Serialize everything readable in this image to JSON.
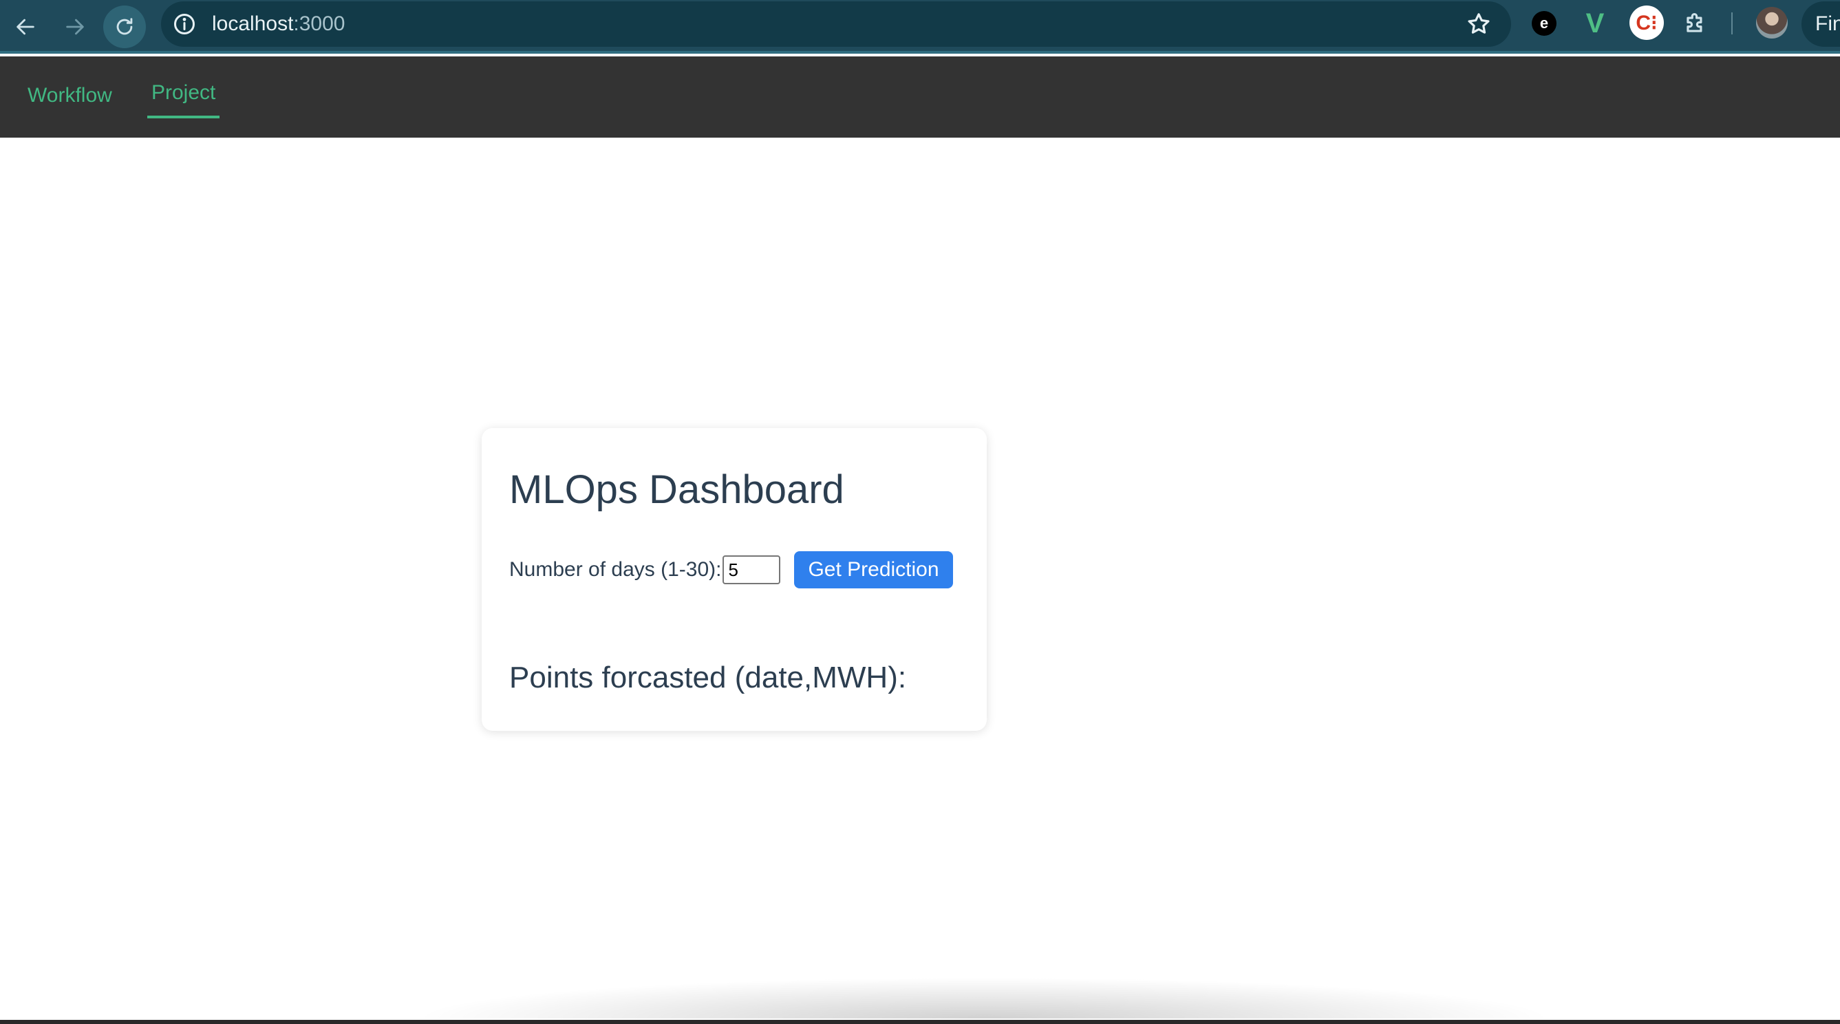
{
  "browser": {
    "url_host": "localhost",
    "url_port": ":3000",
    "profile_label": "Fin",
    "icons": [
      "back-arrow-icon",
      "forward-arrow-icon",
      "reload-icon",
      "info-icon",
      "star-icon",
      "extension-e-icon",
      "vue-devtools-icon",
      "extension-c-icon",
      "puzzle-icon",
      "avatar"
    ],
    "extensions": {
      "e_glyph": "e",
      "v_glyph": "V",
      "c_glyph": "C⁝"
    }
  },
  "nav": {
    "workflow_label": "Workflow",
    "project_label": "Project",
    "active": "Project",
    "accent_color": "#41b883"
  },
  "dashboard": {
    "title": "MLOps Dashboard",
    "days_label": "Number of days (1-30):",
    "days_value": "5",
    "predict_button": "Get Prediction",
    "points_heading": "Points forcasted (date,MWH):",
    "button_color": "#2f80ed"
  }
}
